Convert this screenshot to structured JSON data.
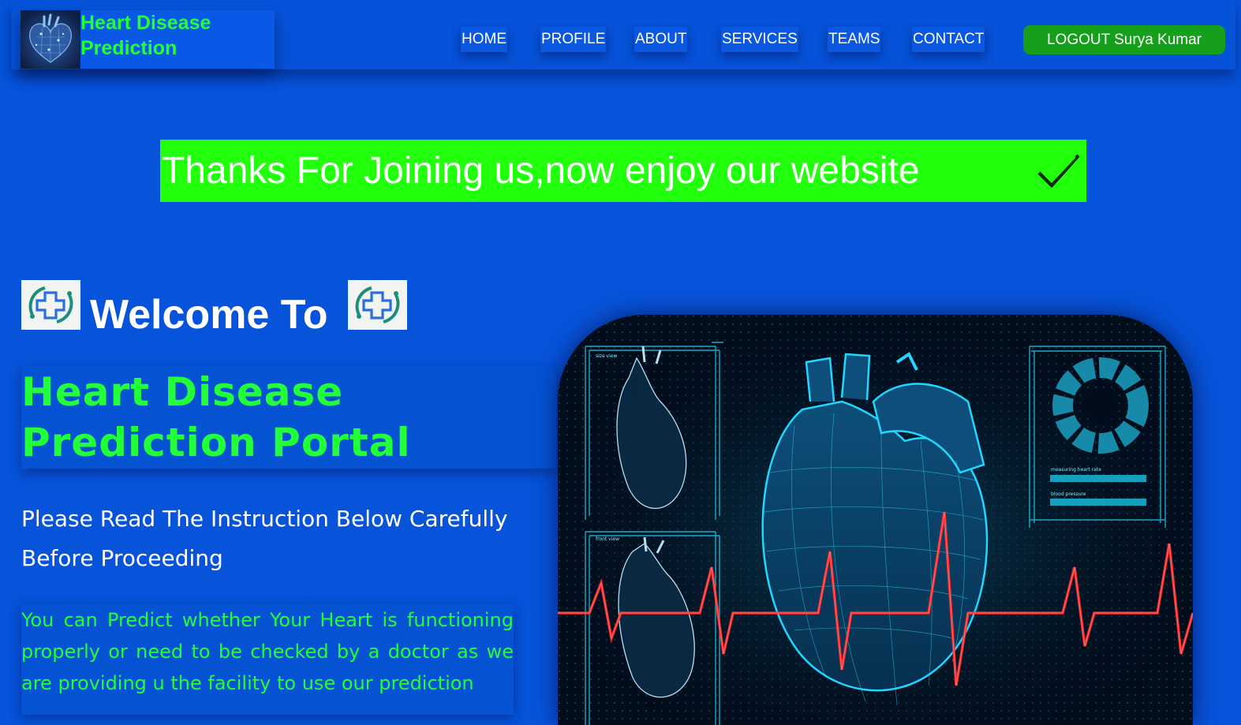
{
  "brand": {
    "title": "Heart Disease Prediction",
    "logo_icon": "heart-hologram-logo"
  },
  "nav": {
    "items": [
      {
        "label": "HOME"
      },
      {
        "label": "PROFILE"
      },
      {
        "label": "ABOUT"
      },
      {
        "label": "SERVICES"
      },
      {
        "label": "TEAMS"
      },
      {
        "label": "CONTACT"
      }
    ],
    "logout_label": "LOGOUT Surya Kumar"
  },
  "banner": {
    "text": "Thanks For Joining us,now enjoy our website",
    "icon": "checkmark-icon"
  },
  "welcome": {
    "text": "Welcome To",
    "logo_icon": "medical-cross-logo"
  },
  "portal": {
    "title": "Heart Disease Prediction Portal"
  },
  "instruction": {
    "text": "Please Read The Instruction Below Carefully Before Proceeding"
  },
  "description": {
    "text": "You can Predict whether Your Heart is functioning properly or need to be checked by a doctor as we are providing u the facility to use our prediction"
  },
  "hero": {
    "image": "heart-hologram-illustration",
    "hud_labels": [
      "size view",
      "front view",
      "measuring heart rate",
      "blood pressure"
    ]
  },
  "colors": {
    "background": "#0753d9",
    "accent_green": "#22ff3a",
    "banner_green": "#22ff0c",
    "logout_green": "#159f1a",
    "heart_cyan": "#19d6ff",
    "ecg_red": "#ff2a2a"
  }
}
